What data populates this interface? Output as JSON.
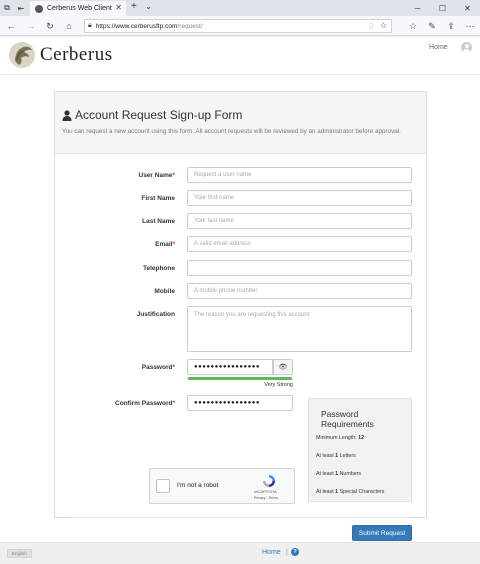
{
  "browser": {
    "tab_title": "Cerberus Web Client",
    "url_host": "https://www.cerberusftp.com",
    "url_path": "/request/"
  },
  "header": {
    "brand": "Cerberus",
    "home_link": "Home"
  },
  "form": {
    "title": "Account Request Sign-up Form",
    "subtitle": "You can request a new account using this form. All account requests will be reviewed by an administrator before approval.",
    "fields": {
      "username": {
        "label": "User Name",
        "required": "*",
        "placeholder": "Request a user name"
      },
      "firstname": {
        "label": "First Name",
        "placeholder": "Your first name"
      },
      "lastname": {
        "label": "Last Name",
        "placeholder": "Your last name"
      },
      "email": {
        "label": "Email",
        "required": "*",
        "placeholder": "A valid email address"
      },
      "telephone": {
        "label": "Telephone",
        "placeholder": ""
      },
      "mobile": {
        "label": "Mobile",
        "placeholder": "A mobile phone number"
      },
      "justification": {
        "label": "Justification",
        "placeholder": "The reason you are requesting this account"
      },
      "password": {
        "label": "Password",
        "required": "*",
        "value": "●●●●●●●●●●●●●●●●"
      },
      "confirm_password": {
        "label": "Confirm Password",
        "required": "*",
        "value": "●●●●●●●●●●●●●●●●"
      }
    },
    "password_strength": {
      "text": "Very Strong",
      "level": 1.0,
      "color": "#5cb85c"
    },
    "requirements": {
      "title": "Password Requirements",
      "min_length_prefix": "Minimum Length:",
      "min_length": "12",
      "letters_prefix": "At least",
      "letters_count": "1",
      "letters_suffix": "Letters",
      "numbers_prefix": "At least",
      "numbers_count": "1",
      "numbers_suffix": "Numbers",
      "special_prefix": "At least",
      "special_count": "1",
      "special_suffix": "Special Characters"
    },
    "captcha": {
      "label": "I'm not a robot",
      "brand": "reCAPTCHA",
      "links": "Privacy - Terms"
    },
    "submit_label": "Submit Request"
  },
  "footer": {
    "language": "English",
    "home_link": "Home",
    "separator": "|",
    "help_icon": "?"
  },
  "colors": {
    "primary": "#337ab7",
    "required": "#cc3333",
    "strength": "#5cb85c"
  },
  "icons": [
    "back-icon",
    "forward-icon",
    "refresh-icon",
    "home-icon",
    "lock-icon",
    "star-icon",
    "user-icon",
    "eye-icon",
    "help-icon"
  ]
}
